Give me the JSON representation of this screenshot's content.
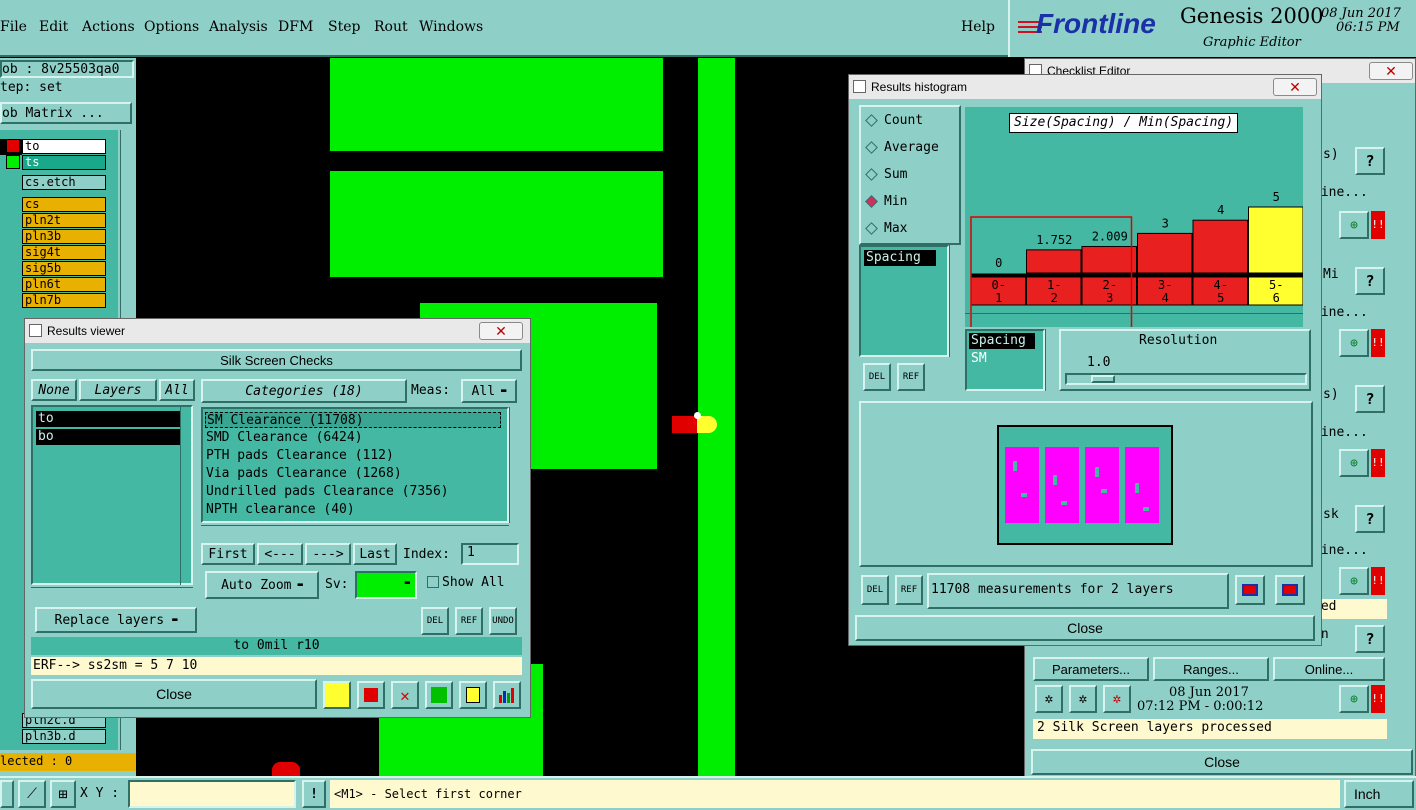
{
  "menu": {
    "items": [
      "File",
      "Edit",
      "Actions",
      "Options",
      "Analysis",
      "DFM",
      "Step",
      "Rout",
      "Windows"
    ],
    "help": "Help"
  },
  "brand": {
    "logo": "Frontline",
    "product": "Genesis 2000",
    "subtitle": "Graphic Editor",
    "date": "08 Jun 2017",
    "time": "06:15 PM"
  },
  "left": {
    "job": "ob : 8v25503qa0",
    "step": "tep: set",
    "matrix": "ob Matrix ...",
    "layers": [
      "to",
      "ts",
      "cs.etch",
      "cs",
      "pln2t",
      "pln3b",
      "sig4t",
      "sig5b",
      "pln6t",
      "pln7b"
    ],
    "bottom_layers": [
      "pln2c.d",
      "pln3b.d"
    ],
    "selected": "lected : 0"
  },
  "results_viewer": {
    "title": "Results viewer",
    "header": "Silk Screen Checks",
    "none": "None",
    "layers_label": "Layers",
    "all": "All",
    "layer_list": [
      "to",
      "bo"
    ],
    "categories": "Categories (18)",
    "meas_label": "Meas:",
    "meas_value": "All",
    "category_items": [
      "SM Clearance (11708)",
      "SMD Clearance (6424)",
      "PTH pads Clearance (112)",
      "Via pads Clearance (1268)",
      "Undrilled pads Clearance (7356)",
      "NPTH clearance (40)"
    ],
    "nav": {
      "first": "First",
      "prev": "<---",
      "next": "--->",
      "last": "Last",
      "index_label": "Index:",
      "index_value": "1"
    },
    "auto_zoom": "Auto Zoom",
    "sv": "Sv:",
    "show_all": "Show All",
    "replace": "Replace layers",
    "del": "DEL",
    "ref": "REF",
    "undo": "UNDO",
    "status": "to 0mil  r10",
    "erf": "ERF--> ss2sm = 5 7 10",
    "close": "Close"
  },
  "histogram": {
    "title": "Results histogram",
    "options": [
      "Count",
      "Average",
      "Sum",
      "Min",
      "Max"
    ],
    "selected_option": "Min",
    "heading": "Size(Spacing) / Min(Spacing)",
    "list_item": "Spacing",
    "list2": [
      "Spacing",
      "SM"
    ],
    "resolution_label": "Resolution",
    "resolution_value": "1.0",
    "del": "DEL",
    "ref": "REF",
    "summary": "11708 measurements for 2 layers",
    "close": "Close"
  },
  "chart_data": {
    "type": "bar",
    "categories": [
      "0-1",
      "1-2",
      "2-3",
      "3-4",
      "4-5",
      "5-6"
    ],
    "values": [
      0,
      1.752,
      2.009,
      3,
      4,
      5
    ],
    "data_labels": [
      "0",
      "1.752",
      "2.009",
      "3",
      "4",
      "5"
    ],
    "colors": [
      "#e82020",
      "#e82020",
      "#e82020",
      "#e82020",
      "#e82020",
      "#ffff30"
    ],
    "title": "Size(Spacing) / Min(Spacing)",
    "xlabel": "",
    "ylabel": "",
    "ylim": [
      0,
      5
    ]
  },
  "checklist": {
    "title": "Checklist Editor",
    "row_fragments": [
      "s)",
      "line...",
      "Mi",
      "line...",
      "s)",
      "line...",
      "sk",
      "line...",
      "sed",
      "en"
    ],
    "parameters": "Parameters...",
    "ranges": "Ranges...",
    "online": "Online...",
    "date": "08 Jun 2017",
    "time": "07:12 PM - 0:00:12",
    "status": "2 Silk Screen layers processed",
    "close": "Close"
  },
  "statusbar": {
    "xy_label": "X Y :",
    "xy_value": "",
    "prompt": "<M1> - Select first corner",
    "units": "Inch"
  },
  "colors": {
    "teal": "#8ecfc7",
    "dark_teal": "#45b8a4",
    "copper_green": "#00ee00",
    "red": "#e00000",
    "yellow": "#ffff30",
    "layer_orange": "#e8b000"
  }
}
